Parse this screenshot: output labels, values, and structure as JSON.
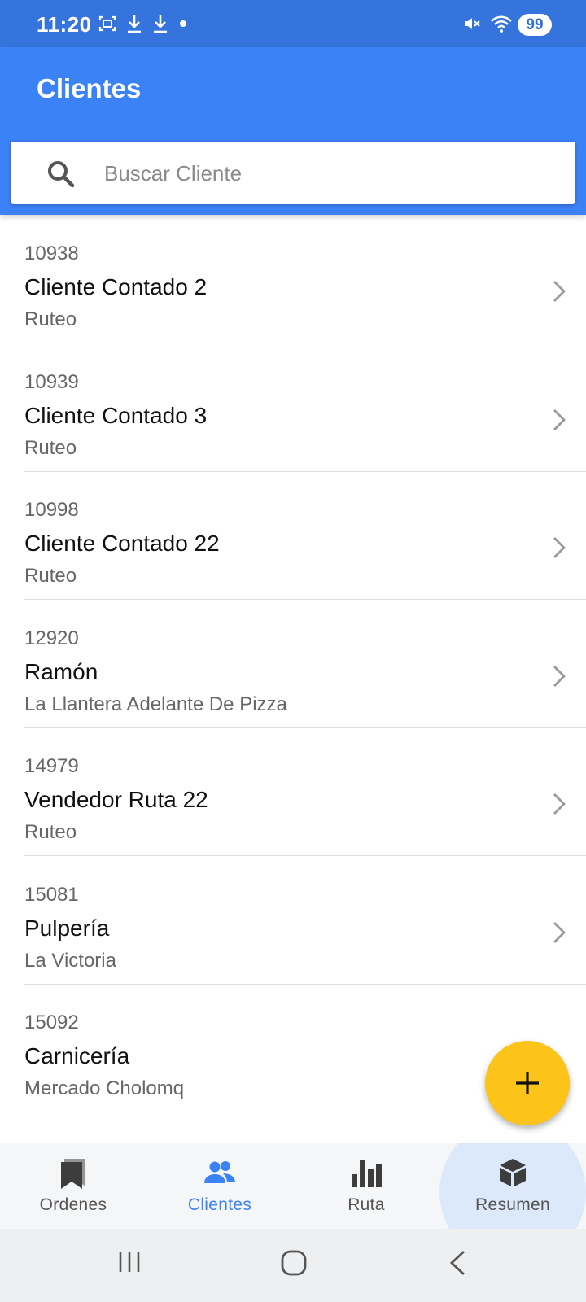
{
  "status_bar": {
    "time": "11:20",
    "battery": "99",
    "left_icons": [
      "screenshot-icon",
      "download-icon",
      "download-icon",
      "dot-icon"
    ],
    "right_icons": [
      "mute-icon",
      "wifi-icon",
      "signal-icon"
    ]
  },
  "app_bar": {
    "title": "Clientes",
    "color": "#3b82f6"
  },
  "search": {
    "placeholder": "Buscar Cliente",
    "value": ""
  },
  "clients": [
    {
      "code": "10938",
      "name": "Cliente Contado 2",
      "address": "Ruteo"
    },
    {
      "code": "10939",
      "name": "Cliente Contado 3",
      "address": "Ruteo"
    },
    {
      "code": "10998",
      "name": "Cliente Contado 22",
      "address": "Ruteo"
    },
    {
      "code": "12920",
      "name": "Ramón",
      "address": "La Llantera Adelante De Pizza"
    },
    {
      "code": "14979",
      "name": "Vendedor Ruta 22",
      "address": "Ruteo"
    },
    {
      "code": "15081",
      "name": "Pulpería",
      "address": "La Victoria"
    },
    {
      "code": "15092",
      "name": "Carnicería",
      "address": "Mercado Cholomq"
    }
  ],
  "fab": {
    "icon": "plus-icon",
    "color": "#fcc419"
  },
  "bottom_nav": {
    "items": [
      {
        "label": "Ordenes",
        "icon": "bookmarks-icon",
        "active": false
      },
      {
        "label": "Clientes",
        "icon": "people-icon",
        "active": true
      },
      {
        "label": "Ruta",
        "icon": "bar-chart-icon",
        "active": false
      },
      {
        "label": "Resumen",
        "icon": "box-icon",
        "active": false
      }
    ],
    "active_color": "#3b82f6"
  },
  "system_nav": [
    "recents-icon",
    "home-icon",
    "back-icon"
  ]
}
